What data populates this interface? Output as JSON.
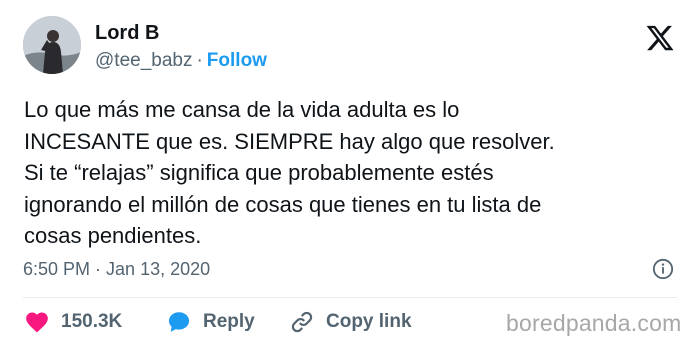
{
  "author": {
    "name": "Lord B",
    "handle": "@tee_babz",
    "separator": "·",
    "follow_label": "Follow"
  },
  "brand": {
    "icon": "x-logo-icon"
  },
  "tweet": {
    "lines": [
      "Lo que más me cansa de la vida adulta es lo",
      "INCESANTE que es. SIEMPRE hay algo que resolver.",
      "Si te “relajas” significa que probablemente estés",
      "ignorando el millón de cosas que tienes en tu lista de",
      "cosas pendientes."
    ]
  },
  "meta": {
    "time": "6:50 PM",
    "separator": "·",
    "date": "Jan 13, 2020",
    "info_icon": "info-icon"
  },
  "actions": {
    "likes": {
      "icon": "heart-icon",
      "label": "150.3K",
      "color": "#f91880"
    },
    "reply": {
      "icon": "reply-bubble-icon",
      "label": "Reply",
      "color": "#1d9bf0"
    },
    "copy": {
      "icon": "link-icon",
      "label": "Copy link"
    }
  },
  "watermark": {
    "text": "boredpanda.com"
  },
  "colors": {
    "text": "#0f1419",
    "secondary": "#536471",
    "accent": "#1d9bf0",
    "like": "#f91880"
  }
}
